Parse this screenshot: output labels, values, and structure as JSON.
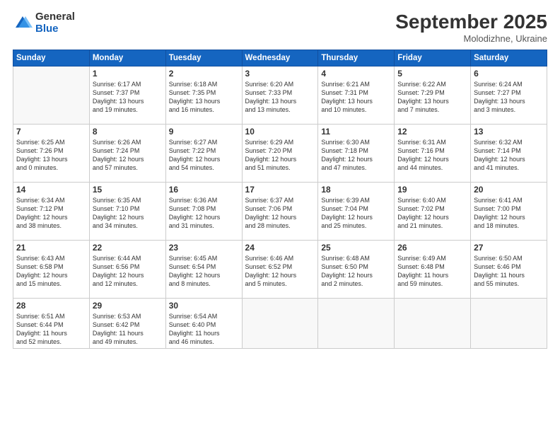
{
  "logo": {
    "general": "General",
    "blue": "Blue"
  },
  "title": "September 2025",
  "location": "Molodizhne, Ukraine",
  "days_of_week": [
    "Sunday",
    "Monday",
    "Tuesday",
    "Wednesday",
    "Thursday",
    "Friday",
    "Saturday"
  ],
  "weeks": [
    [
      {
        "day": "",
        "info": ""
      },
      {
        "day": "1",
        "info": "Sunrise: 6:17 AM\nSunset: 7:37 PM\nDaylight: 13 hours\nand 19 minutes."
      },
      {
        "day": "2",
        "info": "Sunrise: 6:18 AM\nSunset: 7:35 PM\nDaylight: 13 hours\nand 16 minutes."
      },
      {
        "day": "3",
        "info": "Sunrise: 6:20 AM\nSunset: 7:33 PM\nDaylight: 13 hours\nand 13 minutes."
      },
      {
        "day": "4",
        "info": "Sunrise: 6:21 AM\nSunset: 7:31 PM\nDaylight: 13 hours\nand 10 minutes."
      },
      {
        "day": "5",
        "info": "Sunrise: 6:22 AM\nSunset: 7:29 PM\nDaylight: 13 hours\nand 7 minutes."
      },
      {
        "day": "6",
        "info": "Sunrise: 6:24 AM\nSunset: 7:27 PM\nDaylight: 13 hours\nand 3 minutes."
      }
    ],
    [
      {
        "day": "7",
        "info": "Sunrise: 6:25 AM\nSunset: 7:26 PM\nDaylight: 13 hours\nand 0 minutes."
      },
      {
        "day": "8",
        "info": "Sunrise: 6:26 AM\nSunset: 7:24 PM\nDaylight: 12 hours\nand 57 minutes."
      },
      {
        "day": "9",
        "info": "Sunrise: 6:27 AM\nSunset: 7:22 PM\nDaylight: 12 hours\nand 54 minutes."
      },
      {
        "day": "10",
        "info": "Sunrise: 6:29 AM\nSunset: 7:20 PM\nDaylight: 12 hours\nand 51 minutes."
      },
      {
        "day": "11",
        "info": "Sunrise: 6:30 AM\nSunset: 7:18 PM\nDaylight: 12 hours\nand 47 minutes."
      },
      {
        "day": "12",
        "info": "Sunrise: 6:31 AM\nSunset: 7:16 PM\nDaylight: 12 hours\nand 44 minutes."
      },
      {
        "day": "13",
        "info": "Sunrise: 6:32 AM\nSunset: 7:14 PM\nDaylight: 12 hours\nand 41 minutes."
      }
    ],
    [
      {
        "day": "14",
        "info": "Sunrise: 6:34 AM\nSunset: 7:12 PM\nDaylight: 12 hours\nand 38 minutes."
      },
      {
        "day": "15",
        "info": "Sunrise: 6:35 AM\nSunset: 7:10 PM\nDaylight: 12 hours\nand 34 minutes."
      },
      {
        "day": "16",
        "info": "Sunrise: 6:36 AM\nSunset: 7:08 PM\nDaylight: 12 hours\nand 31 minutes."
      },
      {
        "day": "17",
        "info": "Sunrise: 6:37 AM\nSunset: 7:06 PM\nDaylight: 12 hours\nand 28 minutes."
      },
      {
        "day": "18",
        "info": "Sunrise: 6:39 AM\nSunset: 7:04 PM\nDaylight: 12 hours\nand 25 minutes."
      },
      {
        "day": "19",
        "info": "Sunrise: 6:40 AM\nSunset: 7:02 PM\nDaylight: 12 hours\nand 21 minutes."
      },
      {
        "day": "20",
        "info": "Sunrise: 6:41 AM\nSunset: 7:00 PM\nDaylight: 12 hours\nand 18 minutes."
      }
    ],
    [
      {
        "day": "21",
        "info": "Sunrise: 6:43 AM\nSunset: 6:58 PM\nDaylight: 12 hours\nand 15 minutes."
      },
      {
        "day": "22",
        "info": "Sunrise: 6:44 AM\nSunset: 6:56 PM\nDaylight: 12 hours\nand 12 minutes."
      },
      {
        "day": "23",
        "info": "Sunrise: 6:45 AM\nSunset: 6:54 PM\nDaylight: 12 hours\nand 8 minutes."
      },
      {
        "day": "24",
        "info": "Sunrise: 6:46 AM\nSunset: 6:52 PM\nDaylight: 12 hours\nand 5 minutes."
      },
      {
        "day": "25",
        "info": "Sunrise: 6:48 AM\nSunset: 6:50 PM\nDaylight: 12 hours\nand 2 minutes."
      },
      {
        "day": "26",
        "info": "Sunrise: 6:49 AM\nSunset: 6:48 PM\nDaylight: 11 hours\nand 59 minutes."
      },
      {
        "day": "27",
        "info": "Sunrise: 6:50 AM\nSunset: 6:46 PM\nDaylight: 11 hours\nand 55 minutes."
      }
    ],
    [
      {
        "day": "28",
        "info": "Sunrise: 6:51 AM\nSunset: 6:44 PM\nDaylight: 11 hours\nand 52 minutes."
      },
      {
        "day": "29",
        "info": "Sunrise: 6:53 AM\nSunset: 6:42 PM\nDaylight: 11 hours\nand 49 minutes."
      },
      {
        "day": "30",
        "info": "Sunrise: 6:54 AM\nSunset: 6:40 PM\nDaylight: 11 hours\nand 46 minutes."
      },
      {
        "day": "",
        "info": ""
      },
      {
        "day": "",
        "info": ""
      },
      {
        "day": "",
        "info": ""
      },
      {
        "day": "",
        "info": ""
      }
    ]
  ]
}
